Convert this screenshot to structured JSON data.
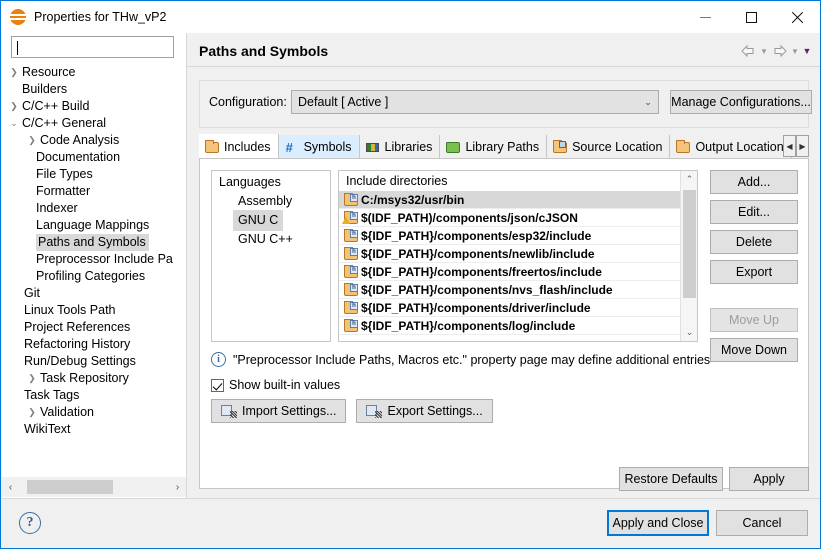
{
  "window": {
    "title": "Properties for THw_vP2",
    "app_icon": "eclipse-icon",
    "minimize": "–",
    "maximize": "□",
    "close": "✕"
  },
  "sidebar": {
    "filter_value": "",
    "filter_placeholder": "",
    "items": [
      {
        "label": "Resource",
        "level": 0,
        "twisty": "collapsed",
        "selected": false
      },
      {
        "label": "Builders",
        "level": 0,
        "twisty": "none",
        "selected": false
      },
      {
        "label": "C/C++ Build",
        "level": 0,
        "twisty": "collapsed",
        "selected": false
      },
      {
        "label": "C/C++ General",
        "level": 0,
        "twisty": "expanded",
        "selected": false
      },
      {
        "label": "Code Analysis",
        "level": 1,
        "twisty": "collapsed",
        "selected": false
      },
      {
        "label": "Documentation",
        "level": 2,
        "twisty": "none",
        "selected": false
      },
      {
        "label": "File Types",
        "level": 2,
        "twisty": "none",
        "selected": false
      },
      {
        "label": "Formatter",
        "level": 2,
        "twisty": "none",
        "selected": false
      },
      {
        "label": "Indexer",
        "level": 2,
        "twisty": "none",
        "selected": false
      },
      {
        "label": "Language Mappings",
        "level": 2,
        "twisty": "none",
        "selected": false
      },
      {
        "label": "Paths and Symbols",
        "level": 2,
        "twisty": "none",
        "selected": true
      },
      {
        "label": "Preprocessor Include Pa",
        "level": 2,
        "twisty": "none",
        "selected": false
      },
      {
        "label": "Profiling Categories",
        "level": 2,
        "twisty": "none",
        "selected": false
      },
      {
        "label": "Git",
        "level": 1,
        "twisty": "none",
        "selected": false
      },
      {
        "label": "Linux Tools Path",
        "level": 1,
        "twisty": "none",
        "selected": false
      },
      {
        "label": "Project References",
        "level": 1,
        "twisty": "none",
        "selected": false
      },
      {
        "label": "Refactoring History",
        "level": 1,
        "twisty": "none",
        "selected": false
      },
      {
        "label": "Run/Debug Settings",
        "level": 1,
        "twisty": "none",
        "selected": false
      },
      {
        "label": "Task Repository",
        "level": 1,
        "twisty": "collapsed",
        "selected": false
      },
      {
        "label": "Task Tags",
        "level": 1,
        "twisty": "none",
        "selected": false
      },
      {
        "label": "Validation",
        "level": 1,
        "twisty": "collapsed",
        "selected": false
      },
      {
        "label": "WikiText",
        "level": 1,
        "twisty": "none",
        "selected": false
      }
    ],
    "hscroll_left": "‹",
    "hscroll_right": "›"
  },
  "header": {
    "page_title": "Paths and Symbols",
    "back_arrow": "⇦",
    "back_caret": "▼",
    "forward_arrow": "⇨",
    "forward_caret": "▼",
    "menu_caret": "▼"
  },
  "configuration": {
    "label": "Configuration:",
    "value": "Default  [ Active ]",
    "dropdown_arrow": "⌄",
    "manage_button": "Manage Configurations..."
  },
  "tabs": {
    "items": [
      {
        "label": "Includes",
        "icon": "folder-include-icon",
        "state": "active"
      },
      {
        "label": "Symbols",
        "icon": "hash-icon",
        "state": "hover"
      },
      {
        "label": "Libraries",
        "icon": "books-icon",
        "state": "normal"
      },
      {
        "label": "Library Paths",
        "icon": "folder-green-icon",
        "state": "normal"
      },
      {
        "label": "Source Location",
        "icon": "folder-source-icon",
        "state": "normal"
      },
      {
        "label": "Output Location",
        "icon": "folder-output-icon",
        "state": "normal"
      }
    ],
    "scroll_left": "◀",
    "scroll_right": "▶"
  },
  "languages": {
    "header": "Languages",
    "items": [
      {
        "label": "Assembly",
        "selected": false
      },
      {
        "label": "GNU C",
        "selected": true
      },
      {
        "label": "GNU C++",
        "selected": false
      }
    ]
  },
  "include_directories": {
    "header": "Include directories",
    "rows": [
      {
        "path": "C:/msys32/usr/bin",
        "selected": true,
        "warning": false
      },
      {
        "path": "$(IDF_PATH)/components/json/cJSON",
        "selected": false,
        "warning": true
      },
      {
        "path": "${IDF_PATH}/components/esp32/include",
        "selected": false,
        "warning": false
      },
      {
        "path": "${IDF_PATH}/components/newlib/include",
        "selected": false,
        "warning": false
      },
      {
        "path": "${IDF_PATH}/components/freertos/include",
        "selected": false,
        "warning": false
      },
      {
        "path": "${IDF_PATH}/components/nvs_flash/include",
        "selected": false,
        "warning": false
      },
      {
        "path": "${IDF_PATH}/components/driver/include",
        "selected": false,
        "warning": false
      },
      {
        "path": "${IDF_PATH}/components/log/include",
        "selected": false,
        "warning": false
      }
    ],
    "scroll_up": "⌃",
    "scroll_down": "⌄"
  },
  "side_buttons": [
    {
      "label": "Add...",
      "enabled": true
    },
    {
      "label": "Edit...",
      "enabled": true
    },
    {
      "label": "Delete",
      "enabled": true
    },
    {
      "label": "Export",
      "enabled": true
    },
    {
      "label": "Move Up",
      "enabled": false
    },
    {
      "label": "Move Down",
      "enabled": true
    }
  ],
  "info": {
    "icon": "info-icon",
    "text": "\"Preprocessor Include Paths, Macros etc.\" property page may define additional entries"
  },
  "builtin": {
    "label": "Show built-in values",
    "checked": true
  },
  "settings_buttons": {
    "import": "Import Settings...",
    "export": "Export Settings..."
  },
  "page_buttons": {
    "restore_defaults": "Restore Defaults",
    "apply": "Apply"
  },
  "footer": {
    "help_icon": "?",
    "apply_and_close": "Apply and Close",
    "cancel": "Cancel"
  },
  "colors": {
    "window_border": "#0078d7",
    "focus_border": "#0078d7",
    "selection": "#d8d8d8",
    "tab_hover": "#dbeeff",
    "panel_bg": "#f0f0f0",
    "list_bg": "#ffffff"
  }
}
